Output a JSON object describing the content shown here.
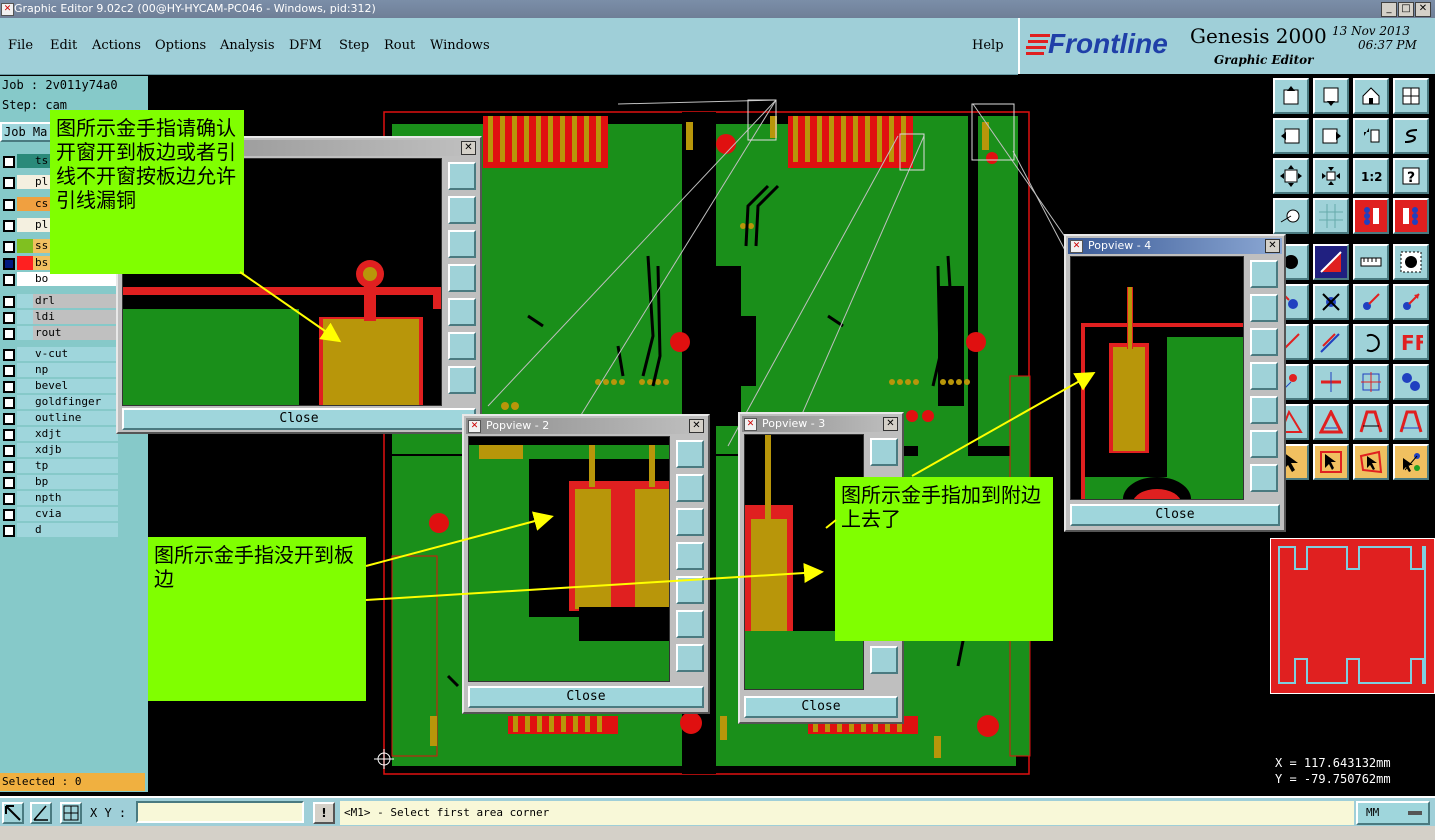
{
  "window": {
    "title": "Graphic Editor 9.02c2 (00@HY-HYCAM-PC046 - Windows, pid:312)"
  },
  "menu": {
    "items": [
      "File",
      "Edit",
      "Actions",
      "Options",
      "Analysis",
      "DFM",
      "Step",
      "Rout",
      "Windows"
    ],
    "help": "Help"
  },
  "brand": {
    "logo": "Frontline",
    "product": "Genesis 2000",
    "subtitle": "Graphic Editor",
    "date": "13 Nov 2013",
    "time": "06:37 PM"
  },
  "job": {
    "job_line": "Job : 2v011y74a0",
    "step_line": "Step: cam",
    "tab_label": "Job Ma",
    "layers": [
      {
        "name": "ts",
        "color": "#2a8a7a"
      },
      {
        "name": "pl",
        "color": ""
      },
      {
        "name": "cs",
        "color": "#f0a040"
      },
      {
        "name": "pl",
        "color": ""
      },
      {
        "name": "ss",
        "color": "#80c020"
      },
      {
        "name": "bs",
        "color": "#ff2020"
      },
      {
        "name": "bo",
        "color": ""
      },
      {
        "name": "drl",
        "color": ""
      },
      {
        "name": "ldi",
        "color": ""
      },
      {
        "name": "rout",
        "color": ""
      },
      {
        "name": "v-cut",
        "color": ""
      },
      {
        "name": "np",
        "color": ""
      },
      {
        "name": "bevel",
        "color": ""
      },
      {
        "name": "goldfinger",
        "color": ""
      },
      {
        "name": "outline",
        "color": ""
      },
      {
        "name": "xdjt",
        "color": ""
      },
      {
        "name": "xdjb",
        "color": ""
      },
      {
        "name": "tp",
        "color": ""
      },
      {
        "name": "bp",
        "color": ""
      },
      {
        "name": "npth",
        "color": ""
      },
      {
        "name": "cvia",
        "color": ""
      },
      {
        "name": "d",
        "color": ""
      }
    ],
    "selected": "Selected : 0"
  },
  "popups": {
    "p1": {
      "close": "Close"
    },
    "p2": {
      "title": "Popview - 2",
      "close": "Close"
    },
    "p3": {
      "title": "Popview - 3",
      "close": "Close"
    },
    "p4": {
      "title": "Popview - 4",
      "close": "Close"
    }
  },
  "notes": {
    "n1": "图所示金手指请确认开窗开到板边或者引线不开窗按板边允许引线漏铜",
    "n2": "图所示金手指没开到板边",
    "n3": "图所示金手指加到附边上去了"
  },
  "coords": {
    "x": "X  =  117.643132mm",
    "y": "Y  = -79.750762mm"
  },
  "status": {
    "xy_label": "X Y :",
    "xy_value": "",
    "message": "<M1> - Select first area corner",
    "units": "MM"
  },
  "colors": {
    "copper": "#1a8f1a",
    "trace": "#ff1010",
    "gold": "#b8960a",
    "note": "#80ff00"
  }
}
